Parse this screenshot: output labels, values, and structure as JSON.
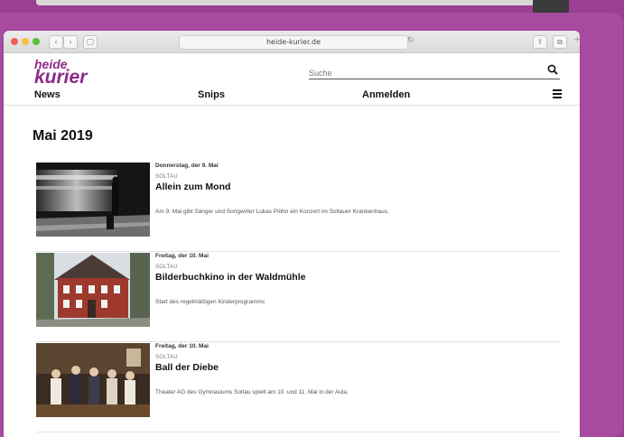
{
  "browser": {
    "url": "heide-kurier.de",
    "back": "‹",
    "forward": "›",
    "sidebar_glyph": "▢",
    "reload_glyph": "↻",
    "share_glyph": "⇪",
    "tabs_glyph": "⧉",
    "new_tab_glyph": "+"
  },
  "site": {
    "logo_line1": "heide",
    "logo_line2": "kurier",
    "search_placeholder": "Suche",
    "nav": {
      "news": "News",
      "snips": "Snips",
      "anmelden": "Anmelden"
    }
  },
  "colors": {
    "brand": "#8b2a8a",
    "background": "#9a3f93"
  },
  "main": {
    "month_heading": "Mai 2019",
    "articles": [
      {
        "date": "Donnerstag, der 9. Mai",
        "location": "SOLTAU",
        "title": "Allein zum Mond",
        "teaser": "Am 9. Mai gibt Sänger und Songwriter Lukas Plöhn ein Konzert im Soltauer Krankenhaus."
      },
      {
        "date": "Freitag, der 10. Mai",
        "location": "SOLTAU",
        "title": "Bilderbuchkino in der Waldmühle",
        "teaser": "Start des regelmäßigen Kinderprogramms"
      },
      {
        "date": "Freitag, der 10. Mai",
        "location": "SOLTAU",
        "title": "Ball der Diebe",
        "teaser": "Theater AG des Gymnasiums Soltau spielt am 10. und 11. Mai in der Aula."
      }
    ]
  },
  "icons": {
    "search": "search-icon",
    "menu": "hamburger-menu-icon"
  }
}
